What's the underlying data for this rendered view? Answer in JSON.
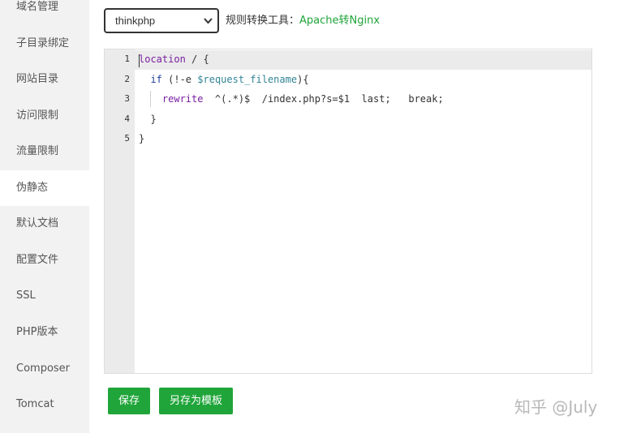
{
  "sidebar": {
    "items": [
      {
        "label": "域名管理"
      },
      {
        "label": "子目录绑定"
      },
      {
        "label": "网站目录"
      },
      {
        "label": "访问限制"
      },
      {
        "label": "流量限制"
      },
      {
        "label": "伪静态",
        "active": true
      },
      {
        "label": "默认文档"
      },
      {
        "label": "配置文件"
      },
      {
        "label": "SSL"
      },
      {
        "label": "PHP版本"
      },
      {
        "label": "Composer"
      },
      {
        "label": "Tomcat"
      }
    ]
  },
  "toolbar": {
    "template_select_value": "thinkphp",
    "rule_convert_label": "规则转换工具：",
    "rule_convert_link": "Apache转Nginx"
  },
  "editor": {
    "line_numbers": [
      "1",
      "2",
      "3",
      "4",
      "5"
    ],
    "lines": {
      "l1_kw": "location",
      "l1_rest": " / {",
      "l2_indent": "  ",
      "l2_kw": "if",
      "l2_mid": " (!-e ",
      "l2_var": "$request_filename",
      "l2_end": "){",
      "l3_indent": "    ",
      "l3_kw": "rewrite",
      "l3_rest": "  ^(.*)$  /index.php?s=$1  last;   break;",
      "l4": "  }",
      "l5": "}"
    }
  },
  "buttons": {
    "save_label": "保存",
    "save_as_template_label": "另存为模板"
  },
  "watermark": "知乎 @July",
  "colors": {
    "accent_green": "#20a53a",
    "sidebar_bg": "#f2f2f2",
    "keyword_purple": "#7a1ea1",
    "variable_teal": "#318495"
  }
}
